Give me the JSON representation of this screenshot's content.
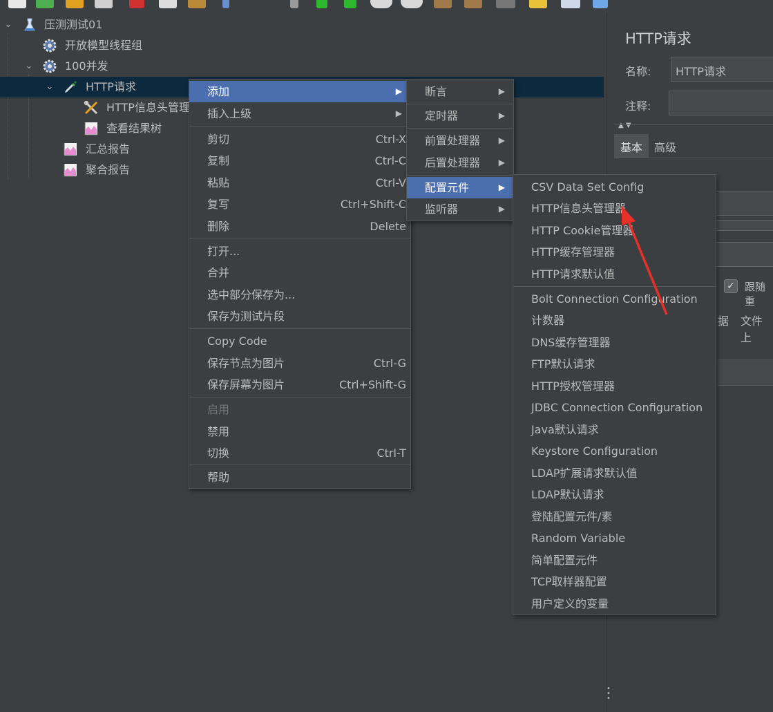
{
  "toolbar": {
    "icons": [
      "new-icon",
      "templates-icon",
      "open-icon",
      "save-icon",
      "cut-icon",
      "copy-icon",
      "paste-icon",
      "expand-icon",
      "toggle-icon",
      "start-icon",
      "start-no-pause-icon",
      "stop-icon",
      "shutdown-icon",
      "clear-icon",
      "clear-all-icon",
      "search-icon",
      "reset-search-icon",
      "function-helper-icon",
      "help-icon"
    ]
  },
  "tree": {
    "root": "压测测试01",
    "open_model_thread_group": "开放模型线程组",
    "thread_group": "100并发",
    "http_request": "HTTP请求",
    "header_manager": "HTTP信息头管理",
    "results_tree": "查看结果树",
    "summary_report": "汇总报告",
    "aggregate_report": "聚合报告"
  },
  "context_menu": {
    "add": "添加",
    "insert_parent": "插入上级",
    "cut": "剪切",
    "cut_key": "Ctrl-X",
    "copy": "复制",
    "copy_key": "Ctrl-C",
    "paste": "粘贴",
    "paste_key": "Ctrl-V",
    "duplicate": "复写",
    "duplicate_key": "Ctrl+Shift-C",
    "remove": "删除",
    "remove_key": "Delete",
    "open": "打开...",
    "merge": "合并",
    "save_selection_as": "选中部分保存为...",
    "save_as_fragment": "保存为测试片段",
    "copy_code": "Copy Code",
    "save_node_as_image": "保存节点为图片",
    "save_node_key": "Ctrl-G",
    "save_screen_as_image": "保存屏幕为图片",
    "save_screen_key": "Ctrl+Shift-G",
    "enable": "启用",
    "disable": "禁用",
    "toggle": "切换",
    "toggle_key": "Ctrl-T",
    "help": "帮助"
  },
  "add_submenu": {
    "assertions": "断言",
    "timers": "定时器",
    "pre_processors": "前置处理器",
    "post_processors": "后置处理器",
    "config_elements": "配置元件",
    "listeners": "监听器"
  },
  "config_submenu": {
    "items": [
      "CSV Data Set Config",
      "HTTP信息头管理器",
      "HTTP Cookie管理器",
      "HTTP缓存管理器",
      "HTTP请求默认值",
      "Bolt Connection Configuration",
      "计数器",
      "DNS缓存管理器",
      "FTP默认请求",
      "HTTP授权管理器",
      "JDBC Connection Configuration",
      "Java默认请求",
      "Keystore Configuration",
      "LDAP扩展请求默认值",
      "LDAP默认请求",
      "登陆配置元件/素",
      "Random Variable",
      "简单配置元件",
      "TCP取样器配置",
      "用户定义的变量"
    ]
  },
  "right_panel": {
    "title": "HTTP请求",
    "name_label": "名称:",
    "name_value": "HTTP请求",
    "comment_label": "注释:",
    "comment_value": "",
    "tab_basic": "基本",
    "tab_advanced": "高级",
    "follow_redirects": "跟随重",
    "partial_data": "据",
    "partial_file_upload": "文件上"
  },
  "colors": {
    "background": "#3c3f41",
    "selection": "#0d293e",
    "menu_highlight": "#4b6eaf",
    "annotation_arrow": "#e8302a"
  }
}
